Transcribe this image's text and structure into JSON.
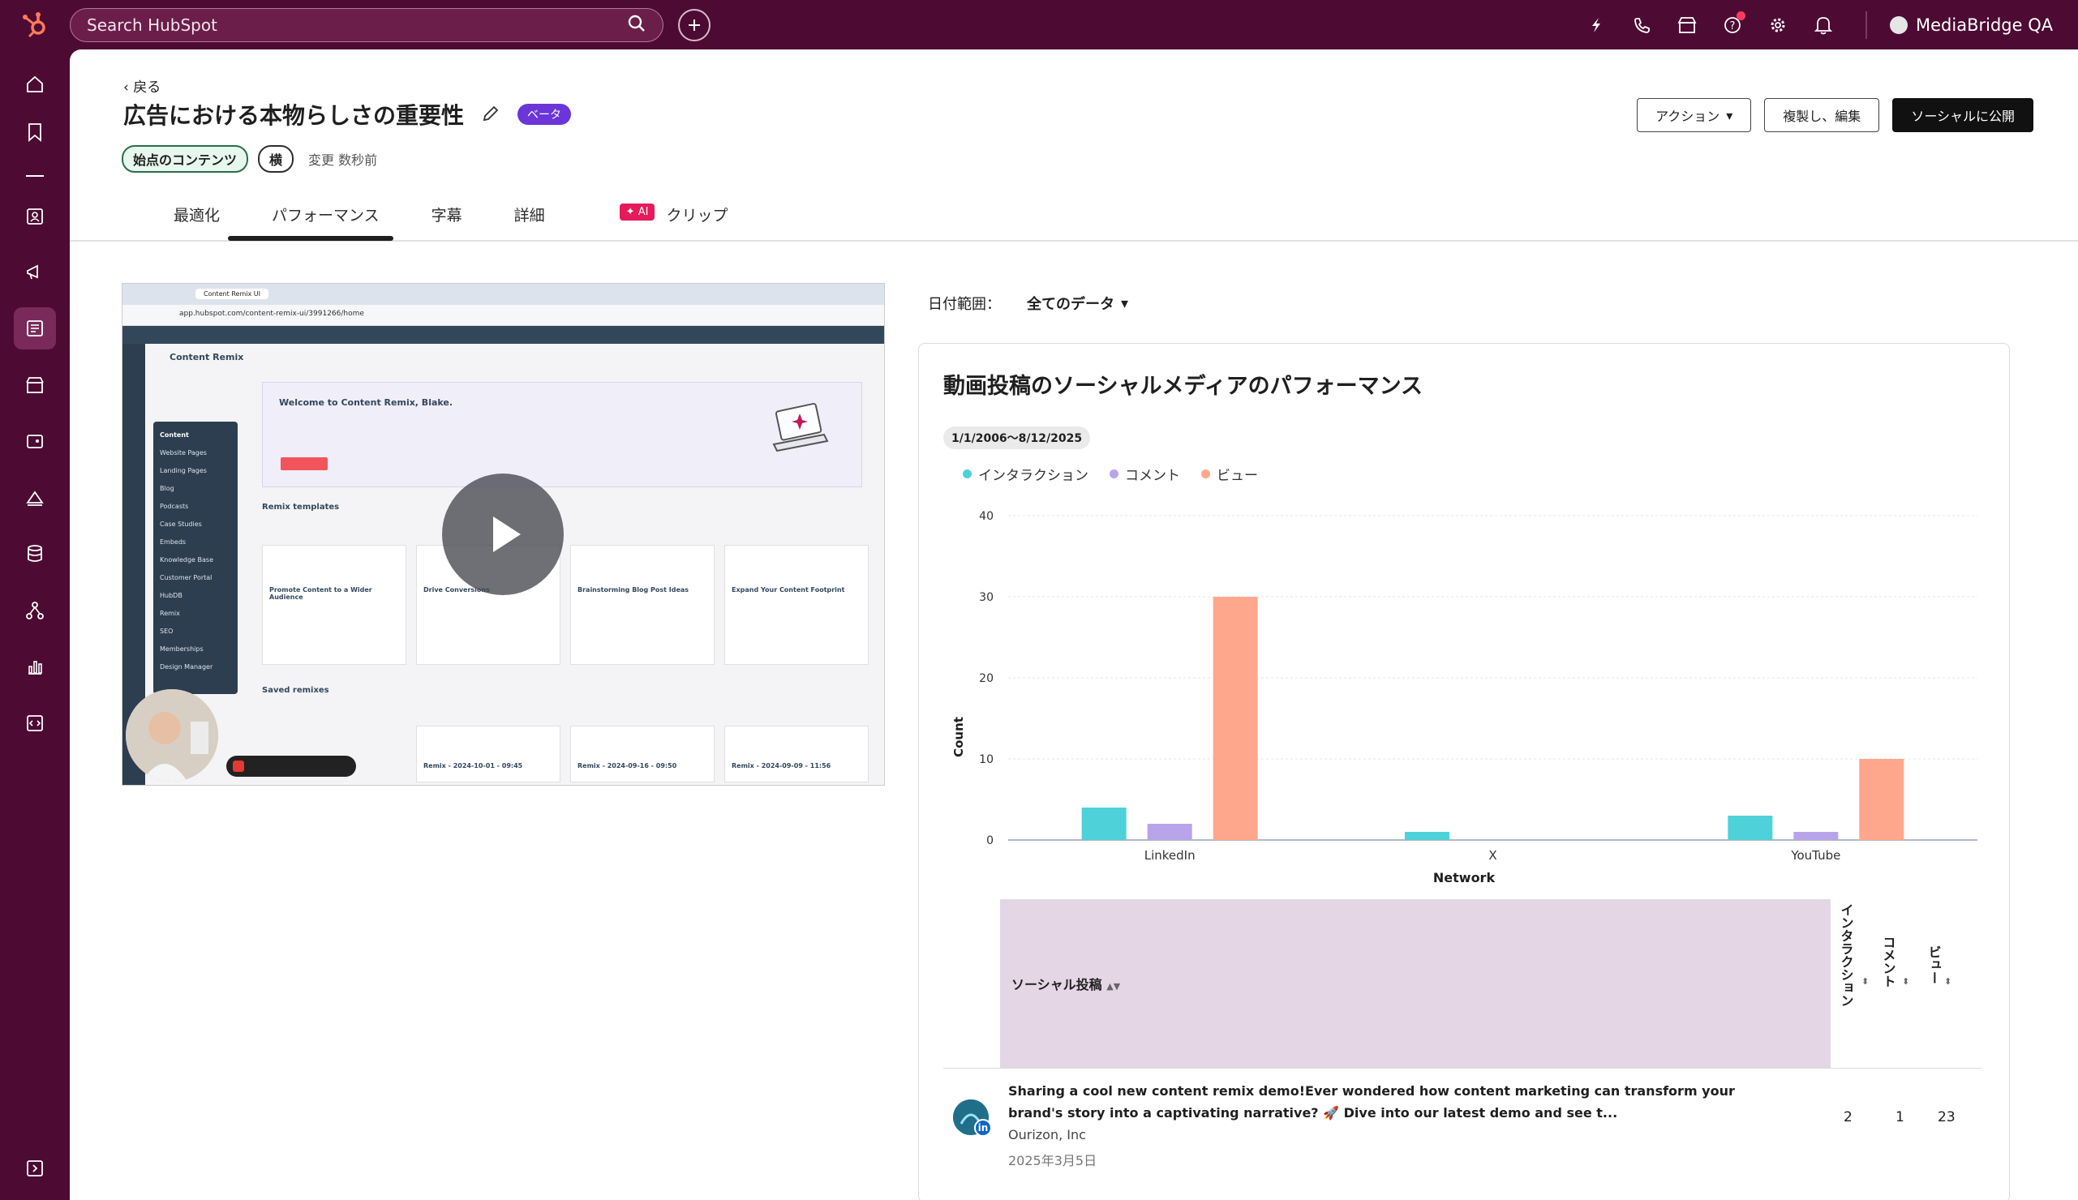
{
  "topbar": {
    "search_placeholder": "Search HubSpot",
    "account_name": "MediaBridge QA",
    "icons": [
      "sparkle-icon",
      "phone-icon",
      "marketplace-icon",
      "help-icon",
      "gear-icon",
      "bell-icon"
    ]
  },
  "sidebar": {
    "items": [
      "home-icon",
      "bookmark-icon",
      "divider",
      "contacts-icon",
      "megaphone-icon",
      "content-icon",
      "commerce-icon",
      "service-icon",
      "automation-icon",
      "data-icon",
      "hierarchy-icon",
      "reports-icon",
      "developer-icon"
    ],
    "active_index": 5,
    "expand_icon": "expand-sidebar-icon"
  },
  "header": {
    "back_label": "戻る",
    "title": "広告における本物らしさの重要性",
    "beta_badge": "ベータ",
    "tag_source": "始点のコンテンツ",
    "tag_orientation": "横",
    "modified": "変更 数秒前"
  },
  "actions": {
    "action_label": "アクション",
    "duplicate_label": "複製し、編集",
    "publish_label": "ソーシャルに公開"
  },
  "tabs": [
    {
      "label": "最適化"
    },
    {
      "label": "パフォーマンス"
    },
    {
      "label": "字幕"
    },
    {
      "label": "詳細"
    },
    {
      "label": "クリップ",
      "badge": "✦ AI"
    }
  ],
  "video": {
    "browser_tab": "Content Remix UI",
    "url": "app.hubspot.com/content-remix-ui/3991266/home",
    "page_heading": "Content Remix",
    "welcome": "Welcome to Content Remix, Blake.",
    "templates_heading": "Remix templates",
    "saved_heading": "Saved remixes",
    "menu_items": [
      "Content",
      "Website Pages",
      "Landing Pages",
      "Blog",
      "Podcasts",
      "Case Studies",
      "Embeds",
      "Knowledge Base",
      "Customer Portal",
      "HubDB",
      "Remix",
      "SEO",
      "Memberships",
      "Design Manager"
    ],
    "cards": [
      "Promote Content to a Wider Audience",
      "Drive Conversions",
      "Brainstorming Blog Post Ideas",
      "Expand Your Content Footprint"
    ],
    "saved": [
      "Remix - 2024-10-01 - 09:45",
      "Remix - 2024-09-16 - 09:50",
      "Remix - 2024-09-09 - 11:56"
    ]
  },
  "date_filter": {
    "label": "日付範囲：",
    "value": "全てのデータ"
  },
  "panel": {
    "title": "動画投稿のソーシャルメディアのパフォーマンス",
    "range": "1/1/2006～8/12/2025"
  },
  "chart_data": {
    "type": "bar",
    "categories": [
      "LinkedIn",
      "X",
      "YouTube"
    ],
    "series": [
      {
        "name": "インタラクション",
        "color": "#4fd1d9",
        "values": [
          4,
          1,
          3
        ]
      },
      {
        "name": "コメント",
        "color": "#b9a4ea",
        "values": [
          2,
          0,
          1
        ]
      },
      {
        "name": "ビュー",
        "color": "#ffa78c",
        "values": [
          30,
          0,
          10
        ]
      }
    ],
    "xlabel": "Network",
    "ylabel": "Count",
    "ylim": [
      0,
      40
    ],
    "yticks": [
      "0",
      "10",
      "20",
      "30",
      "40"
    ],
    "grid": true,
    "legend": "top-left"
  },
  "table": {
    "col_post": "ソーシャル投稿",
    "col_interactions": "インタラクション",
    "col_comments": "コメント",
    "col_views": "ビュー",
    "rows": [
      {
        "text": "Sharing a cool new content remix demo!Ever wondered how content marketing can transform your brand's story into a captivating narrative? 🚀 Dive into our latest demo and see t...",
        "account": "Ourizon, Inc",
        "date": "2025年3月5日",
        "interactions": "2",
        "comments": "1",
        "views": "23"
      }
    ]
  }
}
